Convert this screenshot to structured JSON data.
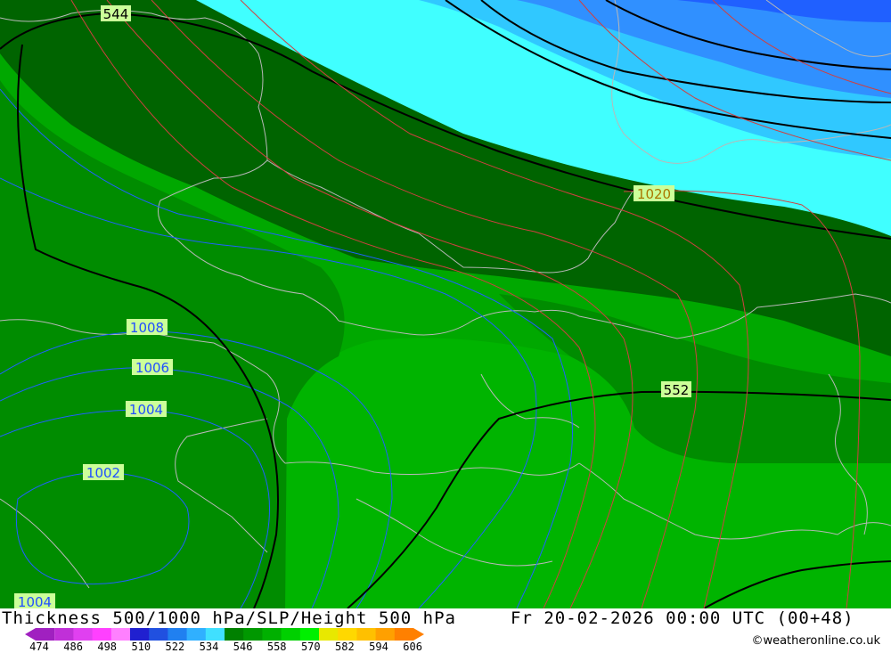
{
  "title": "Thickness 500/1000 hPa/SLP/Height 500 hPa",
  "datetime": "Fr 20-02-2026 00:00 UTC (00+48)",
  "credit": "©weatheronline.co.uk",
  "legend": {
    "ticks": [
      "474",
      "486",
      "498",
      "510",
      "522",
      "534",
      "546",
      "558",
      "570",
      "582",
      "594",
      "606"
    ],
    "colors": [
      "#a020c0",
      "#c030d8",
      "#e040f0",
      "#ff40ff",
      "#ff80ff",
      "#2020d0",
      "#2050e0",
      "#2080f0",
      "#30b0ff",
      "#40e0ff",
      "#008000",
      "#009800",
      "#00b000",
      "#00d000",
      "#00f000",
      "#e8e800",
      "#ffd800",
      "#ffc000",
      "#ffa000",
      "#ff8000"
    ]
  },
  "map_labels": {
    "height_544": "544",
    "height_552": "552",
    "slp_1020": "1020",
    "slp_1008": "1008",
    "slp_1006": "1006",
    "slp_1004": "1004",
    "slp_1002": "1002",
    "slp_1004_b": "1004"
  },
  "colors": {
    "thick_dark": "#006400",
    "thick_mid": "#008c00",
    "thick_light": "#00a800",
    "thick_lighter": "#00b400",
    "cyan": "#40ffff",
    "sky": "#30c8ff",
    "blue": "#3090ff",
    "blue_deep": "#2060ff"
  }
}
